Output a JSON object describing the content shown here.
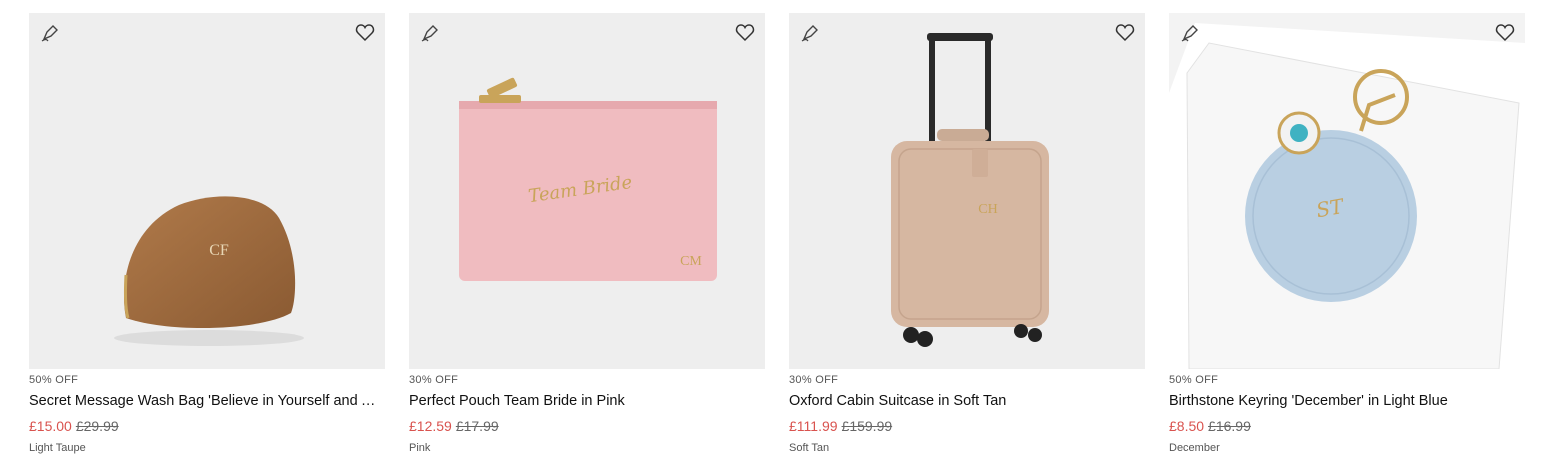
{
  "products": [
    {
      "discount": "50% OFF",
      "name": "Secret Message Wash Bag 'Believe in Yourself and Any...",
      "sale_price": "£15.00",
      "original_price": "£29.99",
      "variant": "Light Taupe",
      "monogram": "CF"
    },
    {
      "discount": "30% OFF",
      "name": "Perfect Pouch Team Bride in Pink",
      "sale_price": "£12.59",
      "original_price": "£17.99",
      "variant": "Pink",
      "monogram": "CM",
      "print": "Team Bride"
    },
    {
      "discount": "30% OFF",
      "name": "Oxford Cabin Suitcase in Soft Tan",
      "sale_price": "£111.99",
      "original_price": "£159.99",
      "variant": "Soft Tan",
      "monogram": "CH"
    },
    {
      "discount": "50% OFF",
      "name": "Birthstone Keyring 'December' in Light Blue",
      "sale_price": "£8.50",
      "original_price": "£16.99",
      "variant": "December",
      "monogram": "ST"
    }
  ],
  "icons": {
    "personalise": "personalise-pen-icon",
    "wishlist": "heart-icon"
  },
  "colors": {
    "sale": "#d9534f",
    "image_bg": "#eeeeee"
  }
}
